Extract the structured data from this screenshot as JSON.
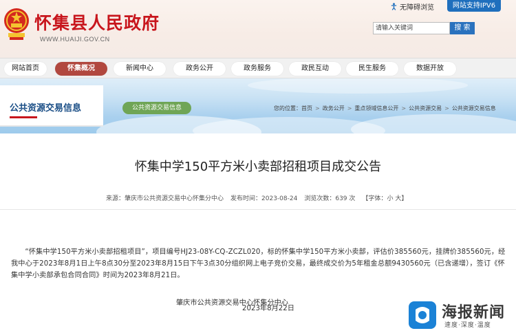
{
  "header": {
    "title": "怀集县人民政府",
    "url": "WWW.HUAIJI.GOV.CN",
    "accessibility_label": "无障碍浏览",
    "ipv6_label": "网站支持IPV6",
    "search_placeholder": "请输入关键词",
    "search_button": "搜 索"
  },
  "nav": {
    "items": [
      {
        "label": "网站首页",
        "active": false
      },
      {
        "label": "怀集概况",
        "active": true
      },
      {
        "label": "新闻中心",
        "active": false
      },
      {
        "label": "政务公开",
        "active": false
      },
      {
        "label": "政务服务",
        "active": false
      },
      {
        "label": "政民互动",
        "active": false
      },
      {
        "label": "民生服务",
        "active": false
      },
      {
        "label": "数据开放",
        "active": false
      }
    ]
  },
  "section": {
    "title": "公共资源交易信息",
    "pill_label": "公共资源交易信息",
    "breadcrumb_prefix": "您的位置：",
    "breadcrumbs": [
      "首页",
      "政务公开",
      "重点领域信息公开",
      "公共资源交易",
      "公共资源交易信息"
    ]
  },
  "article": {
    "title": "怀集中学150平方米小卖部招租项目成交公告",
    "meta": {
      "source": "来源：肇庆市公共资源交易中心怀集分中心",
      "published": "发布时间：2023-08-24",
      "views_label": "浏览次数：",
      "views": "639",
      "views_unit": "次",
      "font_label": "【字体：",
      "font_small": "小",
      "font_large": "大",
      "font_close": "】"
    },
    "body": "“怀集中学150平方米小卖部招租项目”，项目编号HJ23-08Y-CQ-ZCZL020，标的怀集中学150平方米小卖部，评估价385560元，挂牌价385560元，经我中心于2023年8月1日上午8点30分至2023年8月15日下午3点30分组织网上电子竞价交易，最终成交价为5年租金总额9430560元（已含递增），签订《怀集中学小卖部承包合同合同》时间为2023年8月21日。",
    "signature_org": "肇庆市公共资源交易中心怀集分中心",
    "signature_date": "2023年8月22日"
  },
  "watermark": {
    "name": "海报新闻",
    "slogan": "速度·深度·温度"
  },
  "colors": {
    "brand_red": "#c8161d",
    "nav_active": "#b1483f",
    "search_blue": "#2a72be",
    "ipv6_blue": "#1f6fbd",
    "pill_green": "#6fa556",
    "section_title_blue": "#1a4e86"
  }
}
